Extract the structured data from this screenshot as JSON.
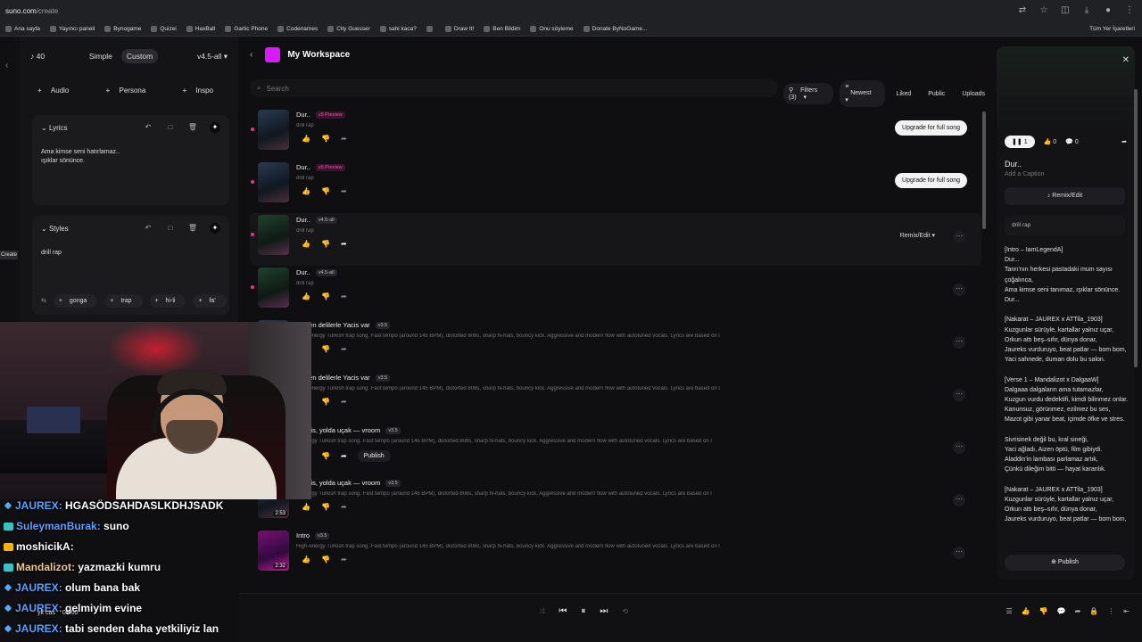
{
  "browser": {
    "url_host": "suno.com",
    "url_path": "/create",
    "bookmarks": [
      "Ana sayfa",
      "Yayıncı paneli",
      "Bynogame",
      "Quizei",
      "HaxBall",
      "Gartic Phone",
      "Codenames",
      "City Guesser",
      "sahi kaca?",
      "",
      "Draw It!",
      "Ben Bildim",
      "Onu söyleme",
      "Donate ByNoGame..."
    ],
    "bookmarks_right": "Tüm Yer İşaretleri"
  },
  "rail": {
    "create_label": "Create"
  },
  "create": {
    "credits": "40",
    "mode_simple": "Simple",
    "mode_custom": "Custom",
    "model": "v4.5-all",
    "add_audio": "Audio",
    "add_persona": "Persona",
    "add_inspo": "Inspo",
    "lyrics_header": "Lyrics",
    "lyrics_line1": "Ama kimse seni hatırlamaz..",
    "lyrics_line2": "ışıklar sönünce.",
    "styles_header": "Styles",
    "styles_value": "drill rap",
    "tags": [
      "gonga",
      "trap",
      "hi-li",
      "fa'"
    ]
  },
  "workspace": {
    "title": "My Workspace",
    "search_placeholder": "Search",
    "filters": "Filters (3)",
    "sort": "Newest",
    "liked": "Liked",
    "public": "Public",
    "uploads": "Uploads",
    "songs": [
      {
        "title": "Dur..",
        "version": "v5 Preview",
        "style": "drill rap",
        "action": "Upgrade for full song"
      },
      {
        "title": "Dur..",
        "version": "v5 Preview",
        "style": "drill rap",
        "action": "Upgrade for full song"
      },
      {
        "title": "Dur..",
        "version": "v4.5-all",
        "style": "drill rap",
        "action": "Remix/Edit"
      },
      {
        "title": "Dur..",
        "version": "v4.5-all",
        "style": "drill rap",
        "action": ""
      },
      {
        "title": "var, en delilerle Yacis var",
        "version": "v3.5",
        "style": "High-energy Turkish trap song. Fast tempo (around 145 BPM), distorted 808s, sharp hi-hats, bouncy kick. Aggressive and modern flow with autotuned vocals. Lyrics are based on l",
        "action": ""
      },
      {
        "title": "var, en delilerle Yacis var",
        "version": "v3.5",
        "style": "High-energy Turkish trap song. Fast tempo (around 145 BPM), distorted 808s, sharp hi-hats, bouncy kick. Aggressive and modern flow with autotuned vocals. Lyrics are based on l",
        "action": ""
      },
      {
        "title": ", Yacis, yolda uçak — vroom",
        "version": "v3.5",
        "style": "h-energy Turkish trap song. Fast tempo (around 145 BPM), distorted 808s, sharp hi-hats, bouncy kick. Aggressive and modern flow with autotuned vocals. Lyrics are based on l",
        "action": "Publish"
      },
      {
        "title": ", Yacis, yolda uçak — vroom",
        "version": "v3.5",
        "style": "h-energy Turkish trap song. Fast tempo (around 145 BPM), distorted 808s, sharp hi-hats, bouncy kick. Aggressive and modern flow with autotuned vocals. Lyrics are based on l",
        "action": "",
        "duration": "2:53"
      },
      {
        "title": "Intro",
        "version": "v3.5",
        "style": "High-energy Turkish trap song. Fast tempo (around 145 BPM), distorted 808s, sharp hi-hats, bouncy kick. Aggressive and modern flow with autotuned vocals. Lyrics are based on l",
        "action": "",
        "duration": "2:32"
      }
    ]
  },
  "detail": {
    "play_count": "1",
    "likes": "0",
    "comments": "0",
    "title": "Dur..",
    "caption": "Add a Caption",
    "remix": "Remix/Edit",
    "style": "drill rap",
    "lyrics": "[Intro – IamLegendA]\nDur...\nTanrı'nın herkesi pastadaki mum sayısı çoğalınca,\nAma kimse seni tanımaz, ışıklar sönünce.\nDur...\n\n[Nakarat – JAUREX x ATTila_1903]\nKuzgunlar sürüyle, kartallar yalnız uçar,\nOrkun attı beş–sıfır, dünya donar,\nJaureks vurduruyo, beat patlar — bom bom,\nYaci sahnede, duman dolu bu salon.\n\n[Verse 1 – Mandalizot x DalgaaW]\nDalgaaa dalgaların ama tutamazlar,\nKuzgun vurdu dedektifi, kimdi bilinmez onlar.\nKanunsuz, görünmez, ezilmez bu ses,\nMazot gibi yanar beat, içimde öfke ve stres.\n\nSivrisinek değil bu, kral sineği,\nYaci ağladı, Aizen öptü, film gibiydi.\nAladdin'in lambası parlamaz artık,\nÇünkü dileğim bitti — hayat karanlık.\n\n[Nakarat – JAUREX x ATTila_1903]\nKuzgunlar sürüyle, kartallar yalnız uçar,\nOrkun attı beş–sıfır, dünya donar,\nJaureks vurduruyo, beat patlar — bom bom,",
    "publish": "Publish"
  },
  "chat": [
    {
      "user": "JAUREX",
      "text": "HGASÖDSAHDASLKDHJSADK",
      "color": "#5aa0ff",
      "badge": "sword"
    },
    {
      "user": "SuleymanBurak",
      "text": "suno",
      "color": "#5aa0ff",
      "badge": "sub"
    },
    {
      "user": "moshicikA",
      "text": "",
      "color": "#ffffff",
      "badge": "crown"
    },
    {
      "user": "Mandalizot",
      "text": "yazmazki kumru",
      "color": "#f0c890",
      "badge": "sub"
    },
    {
      "user": "JAUREX",
      "text": "olum bana bak",
      "color": "#5aa0ff",
      "badge": "sword"
    },
    {
      "user": "JAUREX",
      "text": "gelmiyim evine",
      "color": "#5aa0ff",
      "badge": "sword"
    },
    {
      "user": "JAUREX",
      "text": "tabi senden daha yetkiliyiz lan",
      "color": "#5aa0ff",
      "badge": "sword"
    }
  ],
  "player": {
    "time": "00:00",
    "track": "yk cas"
  }
}
